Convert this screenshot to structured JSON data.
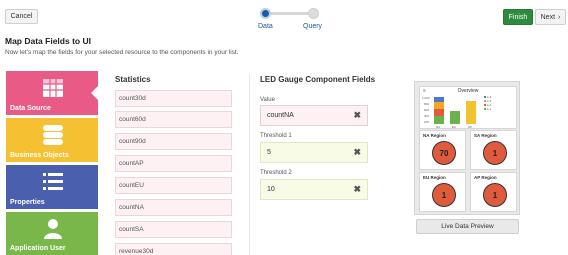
{
  "toolbar": {
    "cancel_label": "Cancel",
    "finish_label": "Finish",
    "next_label": "Next"
  },
  "stepper": {
    "steps": [
      {
        "label": "Data",
        "active": true
      },
      {
        "label": "Query",
        "active": false
      }
    ]
  },
  "header": {
    "title": "Map Data Fields to UI",
    "subtitle": "Now let's map the fields for your selected resource to the components in your list."
  },
  "sidebar": {
    "items": [
      {
        "label": "Data Source",
        "color": "#e95a86",
        "icon": "table-icon",
        "selected": true
      },
      {
        "label": "Business Objects",
        "color": "#f5c031",
        "icon": "database-icon"
      },
      {
        "label": "Properties",
        "color": "#4a5fae",
        "icon": "list-icon"
      },
      {
        "label": "Application User",
        "color": "#79b74a",
        "icon": "user-icon"
      }
    ]
  },
  "statistics": {
    "title": "Statistics",
    "items": [
      "count30d",
      "count60d",
      "count90d",
      "countAP",
      "countEU",
      "countNA",
      "countSA",
      "revenue30d"
    ]
  },
  "gauge_fields": {
    "title": "LED Gauge Component Fields",
    "fields": [
      {
        "label": "Value",
        "value": "countNA",
        "style": "value"
      },
      {
        "label": "Threshold 1",
        "value": "5",
        "style": "thr"
      },
      {
        "label": "Threshold 2",
        "value": "10",
        "style": "thr"
      }
    ]
  },
  "preview": {
    "overview_title": "Overview",
    "overview_chart": {
      "categories": [
        "NA",
        "EU",
        "AP"
      ],
      "legend": [
        "≤ 4",
        "≤ 3",
        "≤ 2",
        "≤ 1"
      ],
      "y_ticks": [
        "1,000",
        "800",
        "600",
        "400",
        "200",
        "0"
      ]
    },
    "cards": [
      {
        "title": "NA Region",
        "value": "70"
      },
      {
        "title": "SA Region",
        "value": "1"
      },
      {
        "title": "EU Region",
        "value": "1"
      },
      {
        "title": "AP Region",
        "value": "1"
      }
    ],
    "live_button_label": "Live Data Preview"
  },
  "colors": {
    "accent": "#1e5aa6",
    "finish": "#2e8b3e",
    "gauge": "#e05a3d"
  }
}
